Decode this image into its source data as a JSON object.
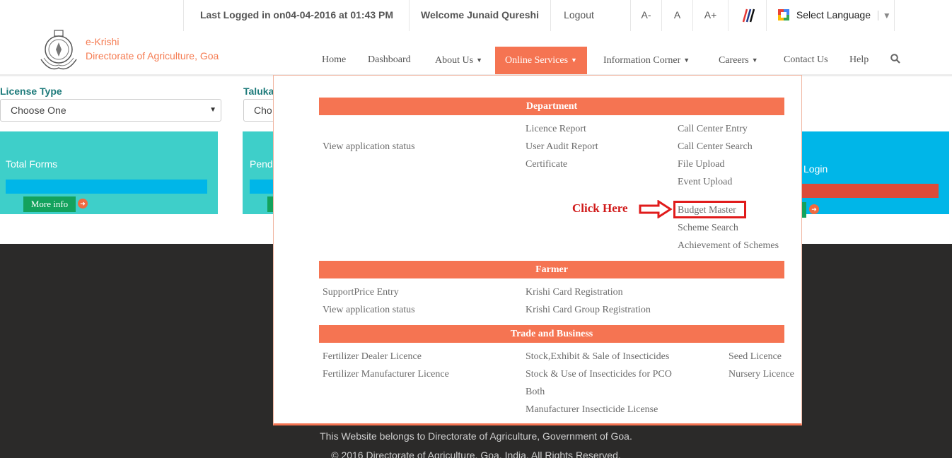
{
  "topbar": {
    "last_logged": "Last Logged in on04-04-2016 at 01:43 PM",
    "welcome": "Welcome Junaid Qureshi",
    "logout": "Logout",
    "font_decrease": "A-",
    "font_normal": "A",
    "font_increase": "A+",
    "select_language": "Select Language"
  },
  "brand": {
    "line1": "e-Krishi",
    "line2": "Directorate of Agriculture, Goa",
    "color": "#f57b51"
  },
  "nav": {
    "home": "Home",
    "dashboard": "Dashboard",
    "about": "About Us",
    "online_services": "Online Services",
    "information_corner": "Information Corner",
    "careers": "Careers",
    "contact": "Contact Us",
    "help": "Help"
  },
  "filters": {
    "license_label": "License Type",
    "license_value": "Choose One",
    "taluka_label": "Taluka",
    "taluka_value": "Cho"
  },
  "cards": {
    "total_forms": "Total Forms",
    "pending": "Pend",
    "login": "Login",
    "more_info": "More info"
  },
  "mega_menu": {
    "department": {
      "header": "Department",
      "col1": [
        "View application status"
      ],
      "col2": [
        "Licence Report",
        "User Audit Report",
        "Certificate"
      ],
      "col3": [
        "Call Center Entry",
        "Call Center Search",
        "File Upload",
        "Event Upload",
        "Budget Master",
        "Scheme Search",
        "Achievement of Schemes"
      ]
    },
    "farmer": {
      "header": "Farmer",
      "col1": [
        "SupportPrice Entry",
        "View application status"
      ],
      "col2": [
        "Krishi Card Registration",
        "Krishi Card Group Registration"
      ]
    },
    "trade": {
      "header": "Trade and Business",
      "col1": [
        "Fertilizer Dealer Licence",
        "Fertilizer Manufacturer Licence"
      ],
      "col2": [
        "Stock,Exhibit & Sale of Insecticides",
        "Stock & Use of Insecticides for PCO",
        "Both",
        "Manufacturer Insecticide License"
      ],
      "col3": [
        "Seed Licence",
        "Nursery Licence"
      ]
    }
  },
  "annotation": {
    "click_here": "Click Here"
  },
  "footer": {
    "line1": "This Website belongs to Directorate of Agriculture, Government of Goa.",
    "line2": "© 2016 Directorate of Agriculture, Goa, India. All Rights Reserved."
  },
  "colors": {
    "accent": "#f57452",
    "teal": "#3ecfc9",
    "cyan": "#00b6e8",
    "green": "#13a25d",
    "red": "#e01b1b"
  }
}
